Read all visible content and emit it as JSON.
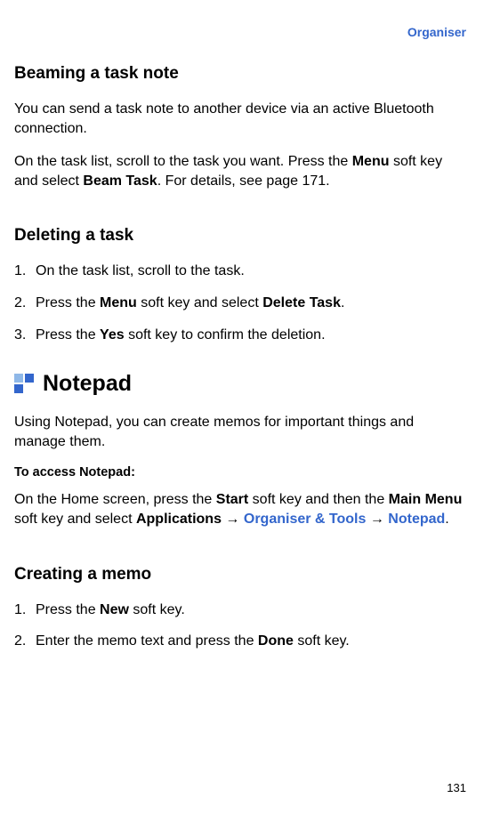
{
  "header": {
    "label": "Organiser"
  },
  "section_beam": {
    "title": "Beaming a task note",
    "p1_a": "You can send a task note to another device via an active Bluetooth connection.",
    "p2_a": "On the task list, scroll to the task you want. Press the ",
    "p2_menu": "Menu",
    "p2_b": " soft key and select ",
    "p2_bold": "Beam Task",
    "p2_c": ". For details, see page 171."
  },
  "section_delete": {
    "title": "Deleting a task",
    "step1": "On the task list, scroll to the task.",
    "step2_a": "Press the ",
    "step2_menu": "Menu",
    "step2_b": " soft key and select ",
    "step2_bold": "Delete Task",
    "step2_c": ".",
    "step3_a": "Press the ",
    "step3_yes": "Yes",
    "step3_b": " soft key to confirm the deletion."
  },
  "section_notepad": {
    "title": "Notepad",
    "intro": "Using Notepad, you can create memos for important things and manage them.",
    "access_title": "To access Notepad:",
    "access_a": "On the Home screen, press the ",
    "access_start": "Start",
    "access_b": " soft key and then the ",
    "access_main": "Main Menu",
    "access_c": " soft key and select ",
    "access_apps": "Applications",
    "access_arrow1": " → ",
    "access_org": "Organiser & Tools",
    "access_arrow2": " → ",
    "access_notepad": "Notepad",
    "access_d": "."
  },
  "section_create": {
    "title": "Creating a memo",
    "step1_a": "Press the ",
    "step1_new": "New",
    "step1_b": " soft key.",
    "step2_a": "Enter the memo text and press the ",
    "step2_done": "Done",
    "step2_b": " soft key."
  },
  "page": {
    "number": "131"
  },
  "list": {
    "n1": "1.",
    "n2": "2.",
    "n3": "3."
  }
}
